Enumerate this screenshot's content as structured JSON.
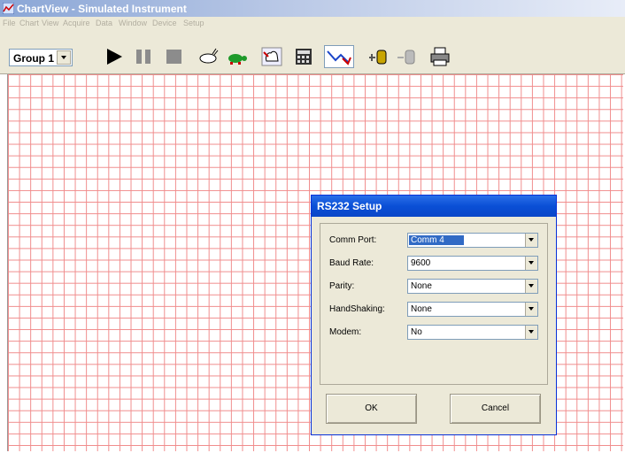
{
  "window": {
    "title": "ChartView - Simulated Instrument"
  },
  "menu": [
    "File",
    "Chart",
    "View",
    "Acquire",
    "Data",
    "Window",
    "Device",
    "Setup"
  ],
  "toolbar": {
    "group_value": "Group 1",
    "buttons": [
      "play-icon",
      "pause-icon",
      "stop-icon",
      "rabbit-icon",
      "turtle-icon",
      "hand-icon",
      "calculator-icon",
      "chart-line-icon",
      "probe-icon",
      "disconnect-icon",
      "printer-icon"
    ]
  },
  "dialog": {
    "title": "RS232 Setup",
    "fields": [
      {
        "label": "Comm Port:",
        "value": "Comm 4"
      },
      {
        "label": "Baud Rate:",
        "value": "9600"
      },
      {
        "label": "Parity:",
        "value": "None"
      },
      {
        "label": "HandShaking:",
        "value": "None"
      },
      {
        "label": "Modem:",
        "value": "No"
      }
    ],
    "ok_label": "OK",
    "cancel_label": "Cancel"
  },
  "colors": {
    "grid": "#f08b8b",
    "title_bar": "#8aa6d6",
    "dialog_title": "#0a4fd6",
    "selection": "#316ac5"
  }
}
